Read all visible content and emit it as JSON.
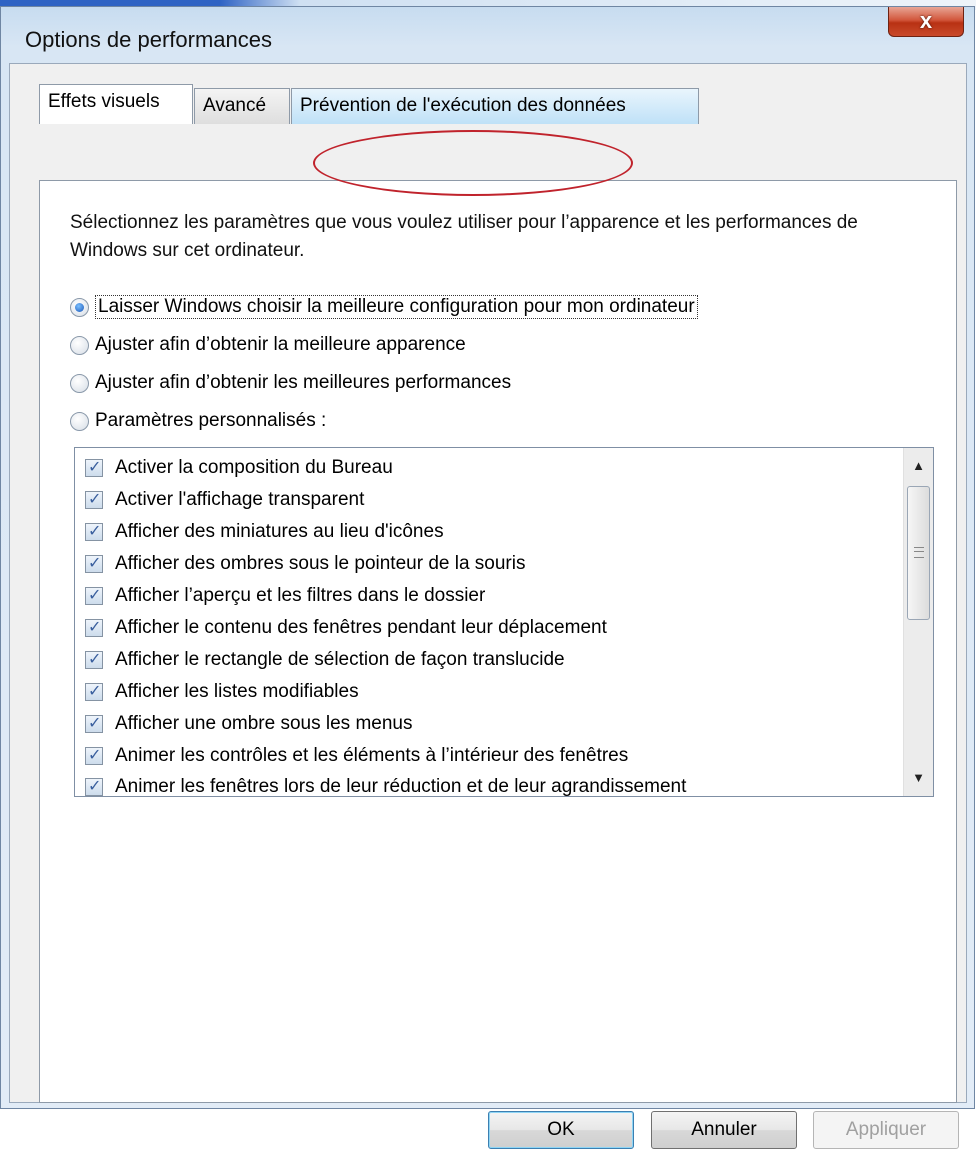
{
  "window": {
    "title": "Options de performances",
    "close_label": "x"
  },
  "tabs": [
    {
      "label": "Effets visuels",
      "active": true
    },
    {
      "label": "Avancé",
      "active": false
    },
    {
      "label": "Prévention de l'exécution des données",
      "active": false
    }
  ],
  "intro_text": "Sélectionnez les paramètres que vous voulez utiliser pour l’apparence et les performances de Windows sur cet ordinateur.",
  "radio_options": [
    {
      "label": "Laisser Windows choisir la meilleure configuration pour mon ordinateur",
      "selected": true
    },
    {
      "label": "Ajuster afin d’obtenir la meilleure apparence",
      "selected": false
    },
    {
      "label": "Ajuster afin d’obtenir les meilleures performances",
      "selected": false
    },
    {
      "label": "Paramètres personnalisés :",
      "selected": false
    }
  ],
  "effects": [
    {
      "label": "Activer la composition du Bureau",
      "checked": true
    },
    {
      "label": "Activer l'affichage transparent",
      "checked": true
    },
    {
      "label": "Afficher des miniatures au lieu d'icônes",
      "checked": true
    },
    {
      "label": "Afficher des ombres sous le pointeur de la souris",
      "checked": true
    },
    {
      "label": "Afficher l’aperçu et les filtres dans le dossier",
      "checked": true
    },
    {
      "label": "Afficher le contenu des fenêtres pendant leur déplacement",
      "checked": true
    },
    {
      "label": "Afficher le rectangle de sélection de façon translucide",
      "checked": true
    },
    {
      "label": "Afficher les listes modifiables",
      "checked": true
    },
    {
      "label": "Afficher une ombre sous les menus",
      "checked": true
    },
    {
      "label": "Animer les contrôles et les éléments à l’intérieur des fenêtres",
      "checked": true
    },
    {
      "label": "Animer les fenêtres lors de leur réduction et de leur agrandissement",
      "checked": true
    }
  ],
  "buttons": {
    "ok": "OK",
    "cancel": "Annuler",
    "apply": "Appliquer"
  },
  "colors": {
    "annotation": "#c0232c",
    "close_button": "#c94a2b"
  }
}
